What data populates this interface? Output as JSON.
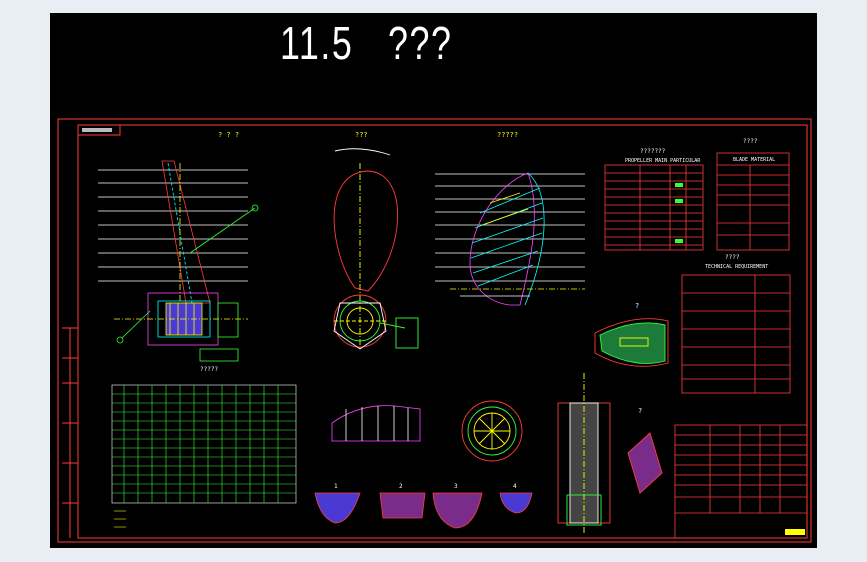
{
  "drawing": {
    "title": "11.5   ???",
    "border_color": "#ff3b3b",
    "line_color": "#ffffff",
    "accent_green": "#33ff33",
    "accent_cyan": "#00ffff",
    "accent_yellow": "#ffff00",
    "accent_magenta": "#ff44ff",
    "views": {
      "front_view_caption": "? ? ?",
      "blade_outline_caption": "???",
      "side_view_caption": "?????",
      "table_caption": "???????",
      "material_caption": "????",
      "tech_caption": "????",
      "section_caption": "?????",
      "detail_caption_a": "?",
      "detail_caption_b": "?",
      "section_labels": [
        "1",
        "2",
        "3",
        "4"
      ]
    },
    "tables": {
      "props_heading": "PROPELLER MAIN PARTICULAR",
      "materials_heading": "BLADE MATERIAL",
      "requirements_heading": "TECHNICAL REQUIREMENT"
    }
  }
}
